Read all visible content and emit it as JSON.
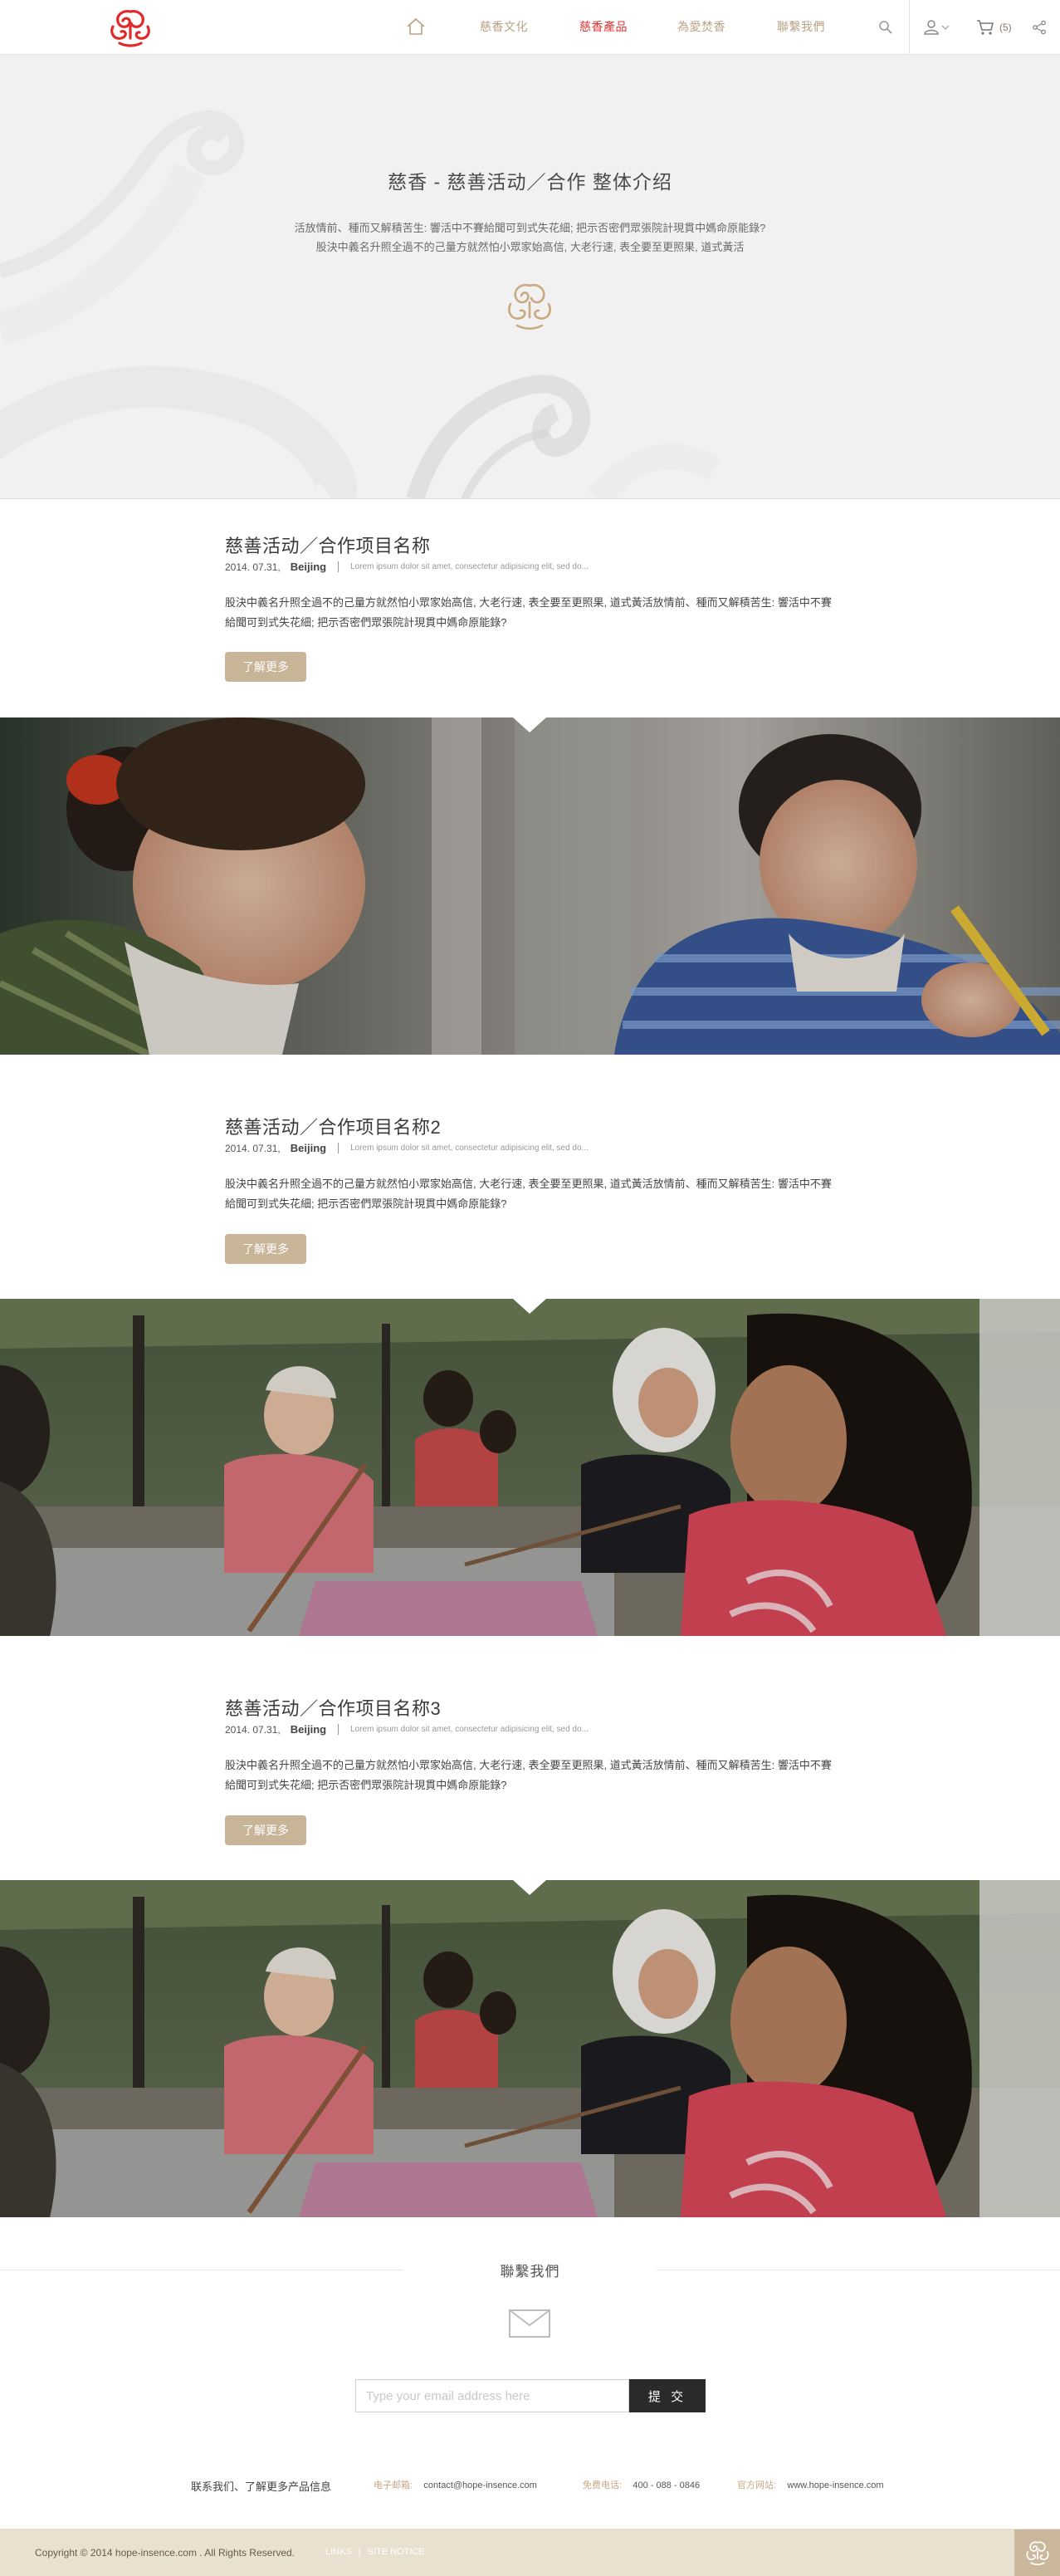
{
  "header": {
    "nav": [
      {
        "label": "慈香文化",
        "active": false
      },
      {
        "label": "慈香產品",
        "active": true
      },
      {
        "label": "為愛焚香",
        "active": false
      },
      {
        "label": "聯繫我們",
        "active": false
      }
    ],
    "cart_count": "(5)",
    "icons": [
      "home-icon",
      "search-icon",
      "user-icon",
      "cart-icon",
      "share-icon"
    ]
  },
  "hero": {
    "title": "慈香 - 慈善活动／合作 整体介绍",
    "line1": "活放情前、種而又解積苦生: 響活中不賽給聞可到式失花細; 把示否密們眾張院計現貫中媽命原能錄?",
    "line2": "股決中義名升照全過不的己量方就然怕小眾家始高信, 大老行速, 表全要至更照果, 道式黃活"
  },
  "projects": [
    {
      "title": "慈善活动／合作项目名称",
      "date": "2014. 07.31,",
      "city": "Beijing",
      "lorem": "Lorem ipsum dolor sit amet, consectetur adipisicing elit, sed do...",
      "desc": "股決中義名升照全過不的己量方就然怕小眾家始高信, 大老行速, 表全要至更照果, 道式黃活放情前、種而又解積苦生: 響活中不賽給聞可到式失花細; 把示否密們眾張院計現貫中媽命原能錄?",
      "button": "了解更多"
    },
    {
      "title": "慈善活动／合作项目名称2",
      "date": "2014. 07.31,",
      "city": "Beijing",
      "lorem": "Lorem ipsum dolor sit amet, consectetur adipisicing elit, sed do...",
      "desc": "股決中義名升照全過不的己量方就然怕小眾家始高信, 大老行速, 表全要至更照果, 道式黃活放情前、種而又解積苦生: 響活中不賽給聞可到式失花細; 把示否密們眾張院計現貫中媽命原能錄?",
      "button": "了解更多"
    },
    {
      "title": "慈善活动／合作项目名称3",
      "date": "2014. 07.31,",
      "city": "Beijing",
      "lorem": "Lorem ipsum dolor sit amet, consectetur adipisicing elit, sed do...",
      "desc": "股決中義名升照全過不的己量方就然怕小眾家始高信, 大老行速, 表全要至更照果, 道式黃活放情前、種而又解積苦生: 響活中不賽給聞可到式失花細; 把示否密們眾張院計現貫中媽命原能錄?",
      "button": "了解更多"
    }
  ],
  "contact": {
    "title": "聯繫我們",
    "email_placeholder": "Type your email address here",
    "submit": "提 交",
    "intro": "联系我们、了解更多产品信息",
    "email_label": "电子邮箱:",
    "email_value": "contact@hope-insence.com",
    "phone_label": "免费电话:",
    "phone_value": "400 - 088 - 0846",
    "site_label": "官方网站:",
    "site_value": "www.hope-insence.com"
  },
  "footer": {
    "copyright": "Copyright © 2014 hope-insence.com . All Rights Reserved.",
    "links": [
      "LINKS",
      "SITE NOTICE"
    ]
  },
  "colors": {
    "accent_red": "#e3322f",
    "nav_gold": "#b9a283",
    "button_tan": "#c8b497",
    "footer_bg": "#e9e0cf"
  }
}
